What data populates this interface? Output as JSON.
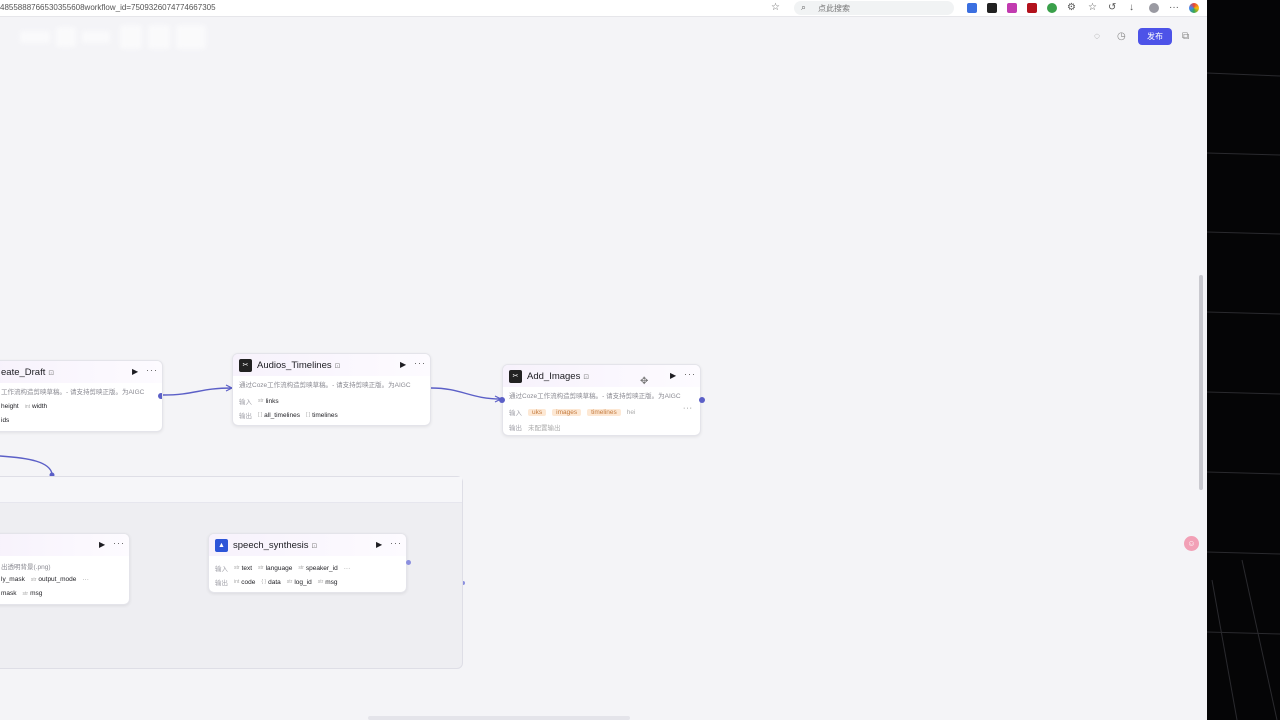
{
  "browser": {
    "url": "4855888766530355608workflow_id=7509326074774667305",
    "search_placeholder": "点此搜索"
  },
  "header": {
    "publish_label": "发布"
  },
  "nodes": {
    "create_draft": {
      "title": "eate_Draft",
      "desc": "工作流构造剪映草稿。- 请支持剪映正版。为AIGC",
      "inputs": [
        "height",
        "width"
      ],
      "outputs_partial": "ids"
    },
    "audios_timelines": {
      "title": "Audios_Timelines",
      "desc": "通过Coze工作流构造剪映草稿。- 请支持剪映正版。为AIGC",
      "input_label": "输入",
      "inputs": [
        "links"
      ],
      "output_label": "输出",
      "outputs": [
        "all_timelines",
        "timelines"
      ]
    },
    "add_images": {
      "title": "Add_Images",
      "desc": "通过Coze工作流构造剪映草稿。- 请支持剪映正版。为AIGC",
      "input_label": "输入",
      "inputs": [
        "uks",
        "images",
        "timelines",
        "hei"
      ],
      "output_label": "输出",
      "no_output": "未配置输出"
    },
    "image_matting": {
      "desc": "出透明背景(.png)",
      "inputs": [
        "ly_mask",
        "output_mode"
      ],
      "outputs": [
        "mask",
        "msg"
      ]
    },
    "speech_synthesis": {
      "title": "speech_synthesis",
      "input_label": "输入",
      "inputs": [
        "text",
        "language",
        "speaker_id"
      ],
      "output_label": "输出",
      "outputs": [
        "code",
        "data",
        "log_id",
        "msg"
      ]
    }
  }
}
